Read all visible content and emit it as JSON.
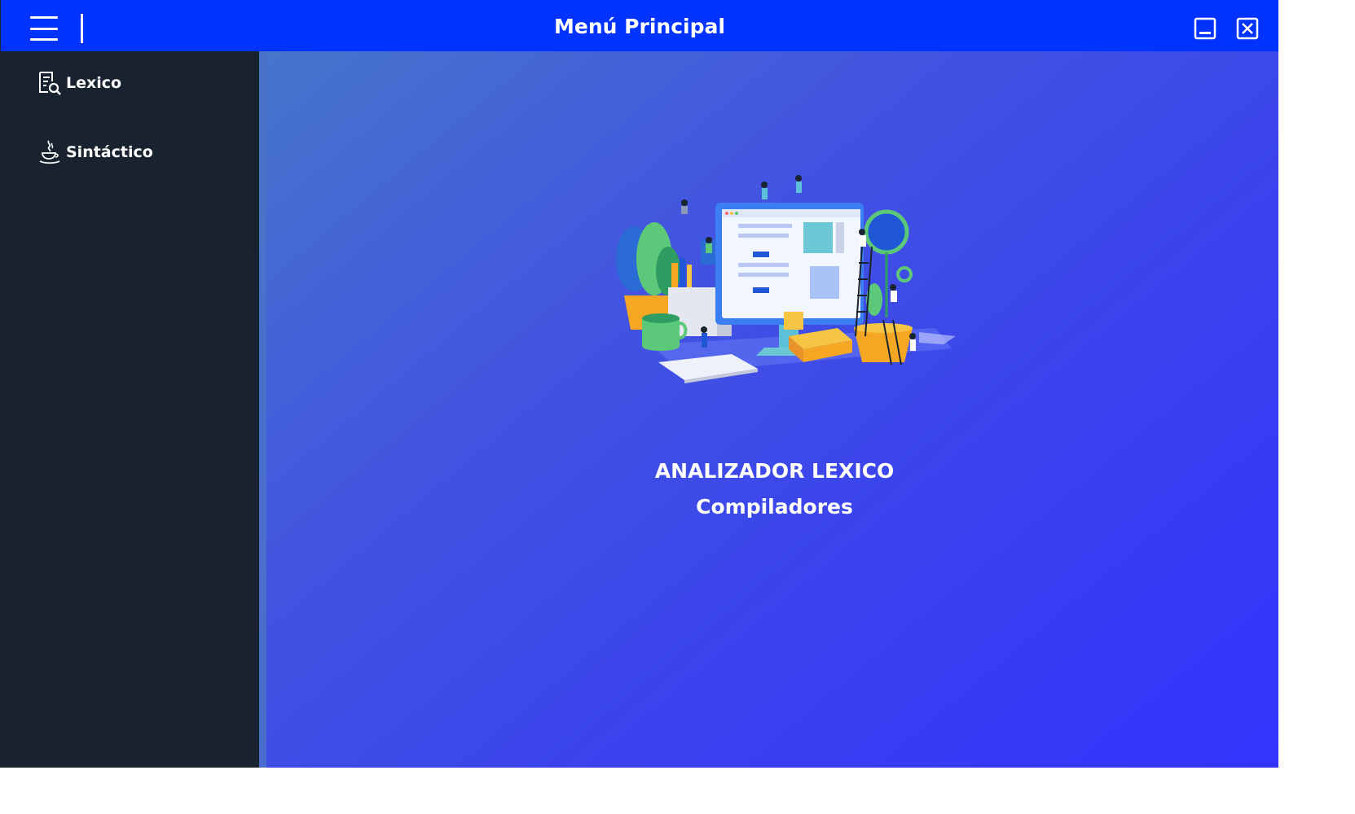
{
  "window": {
    "title": "Menú Principal"
  },
  "titlebar_icons": [
    "hamburger-menu-icon",
    "minimize-icon",
    "close-icon"
  ],
  "sidebar": {
    "items": [
      {
        "label": "Lexico",
        "icon": "document-search-icon"
      },
      {
        "label": "Sintáctico",
        "icon": "java-cup-icon"
      }
    ]
  },
  "main": {
    "heading": "ANALIZADOR LEXICO",
    "subheading": "Compiladores",
    "illustration": "computer-workspace-illustration"
  },
  "colors": {
    "titlebar": "#0033ff",
    "sidebar": "#19222f",
    "main_gradient_start": "#4676cb",
    "main_gradient_end": "#3334fc",
    "text": "#ffffff"
  }
}
